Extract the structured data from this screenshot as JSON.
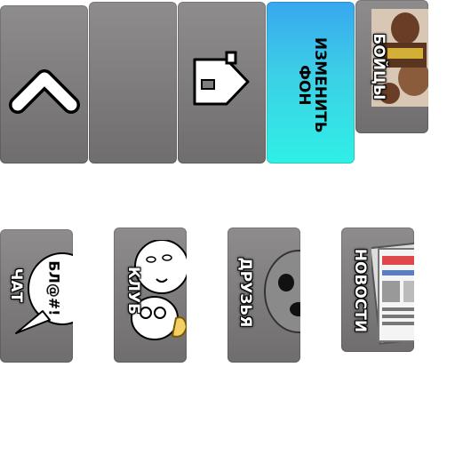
{
  "top_row": {
    "back_label": "",
    "home_label": "",
    "change_bg_line1": "ИЗМЕНИТЬ",
    "change_bg_line2": "ФОН",
    "fighters_label": "БОЙЦЫ"
  },
  "bottom_row": {
    "chat_label": "ЧАТ",
    "chat_bubble_text": "БЛ@#!",
    "club_label": "КЛУБ",
    "friends_label": "ДРУЗЬЯ",
    "news_label": "НОВОСТИ"
  },
  "colors": {
    "tile_gray": "#7e7c7c",
    "blue_top": "#38a7ef",
    "blue_bottom": "#2ff0e6"
  },
  "icons": [
    "chevron-up-icon",
    "home-icon",
    "fighters-photo",
    "speech-bubble-icon",
    "meme-faces-icon",
    "skull-face-icon",
    "newspapers-icon"
  ]
}
